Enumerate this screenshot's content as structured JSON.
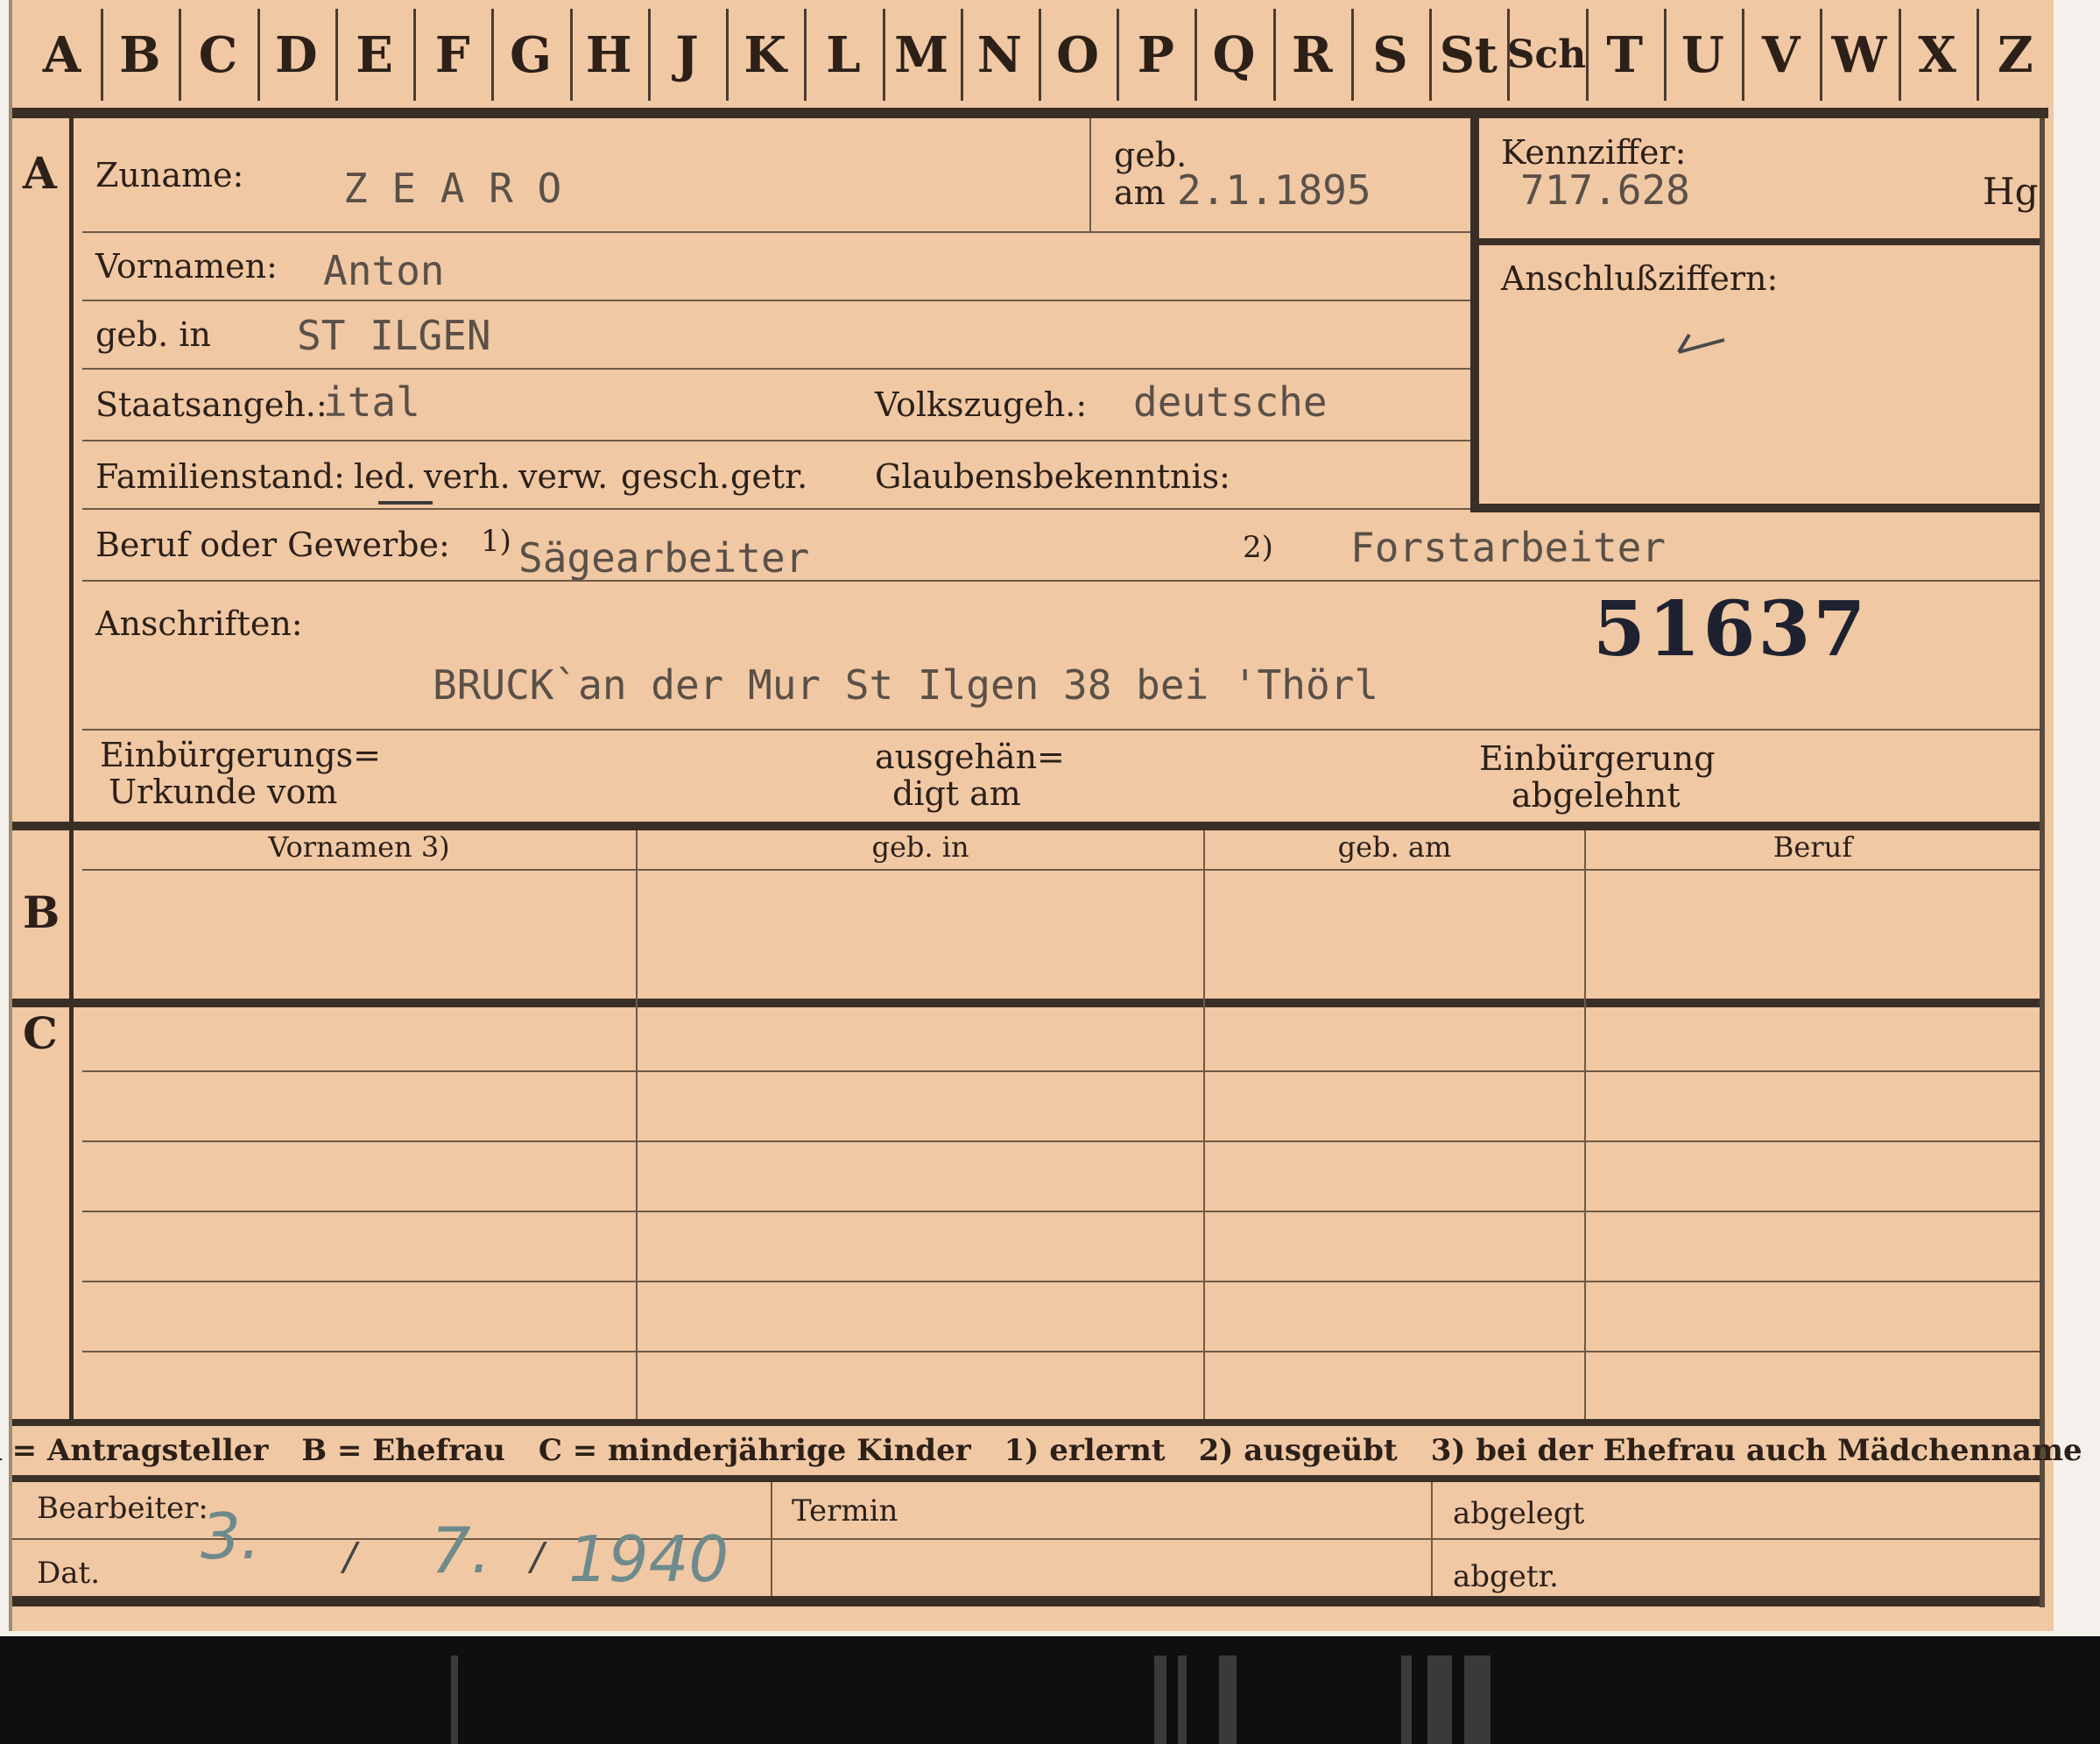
{
  "alphabet_tabs": [
    "A",
    "B",
    "C",
    "D",
    "E",
    "F",
    "G",
    "H",
    "J",
    "K",
    "L",
    "M",
    "N",
    "O",
    "P",
    "Q",
    "R",
    "S",
    "St",
    "Sch",
    "T",
    "U",
    "V",
    "W",
    "X",
    "Z"
  ],
  "sections": {
    "a": "A",
    "b": "B",
    "c": "C"
  },
  "applicant": {
    "zuname_label": "Zuname:",
    "zuname_value": "Z E A R O",
    "geb_label_top": "geb.",
    "geb_label_am": "am",
    "geb_am_value": "2.1.1895",
    "vornamen_label": "Vornamen:",
    "vornamen_value": "Anton",
    "geb_in_label": "geb. in",
    "geb_in_value": "ST ILGEN",
    "staatsangeh_label": "Staatsangeh.:",
    "staatsangeh_value": "ital",
    "volkszugeh_label": "Volkszugeh.:",
    "volkszugeh_value": "deutsche",
    "familienstand_label": "Familienstand:",
    "familienstand_options": [
      "led.",
      "verh.",
      "verw.",
      "gesch.",
      "getr."
    ],
    "glaubens_label": "Glaubensbekenntnis:",
    "beruf_label": "Beruf oder Gewerbe:",
    "beruf_note1": "1)",
    "beruf_value1": "Sägearbeiter",
    "beruf_note2": "2)",
    "beruf_value2": "Forstarbeiter",
    "anschriften_label": "Anschriften:",
    "anschrift_value": "BRUCK`an der Mur   St Ilgen 38 bei 'Thörl",
    "card_number": "51637",
    "einb_urkunde_line1": "Einbürgerungs=",
    "einb_urkunde_line2": "Urkunde vom",
    "ausgehaen_line1": "ausgehän=",
    "ausgehaen_line2": "digt am",
    "einb_abgelehnt_line1": "Einbürgerung",
    "einb_abgelehnt_line2": "abgelehnt"
  },
  "kennziffer": {
    "label": "Kennziffer:",
    "value": "717.628",
    "suffix": "Hg",
    "anschluss_label": "Anschlußziffern:"
  },
  "family_table": {
    "headers": [
      "Vornamen 3)",
      "geb. in",
      "geb. am",
      "Beruf"
    ]
  },
  "legend": [
    "A = Antragsteller",
    "B = Ehefrau",
    "C = minderjährige Kinder",
    "1) erlernt",
    "2) ausgeübt",
    "3) bei der Ehefrau auch Mädchenname"
  ],
  "footer": {
    "bearbeiter_label": "Bearbeiter:",
    "dat_label": "Dat.",
    "termin_label": "Termin",
    "abgelegt_label": "abgelegt",
    "abgetr_label": "abgetr.",
    "date_day": "3.",
    "date_sep1": "/",
    "date_month": "7.",
    "date_sep2": "/",
    "date_year": "1940"
  },
  "colors": {
    "card": "#f0c8a4",
    "ink": "#2c2018",
    "typewriter": "#5a5048",
    "pencil": "#6f8a8c"
  }
}
